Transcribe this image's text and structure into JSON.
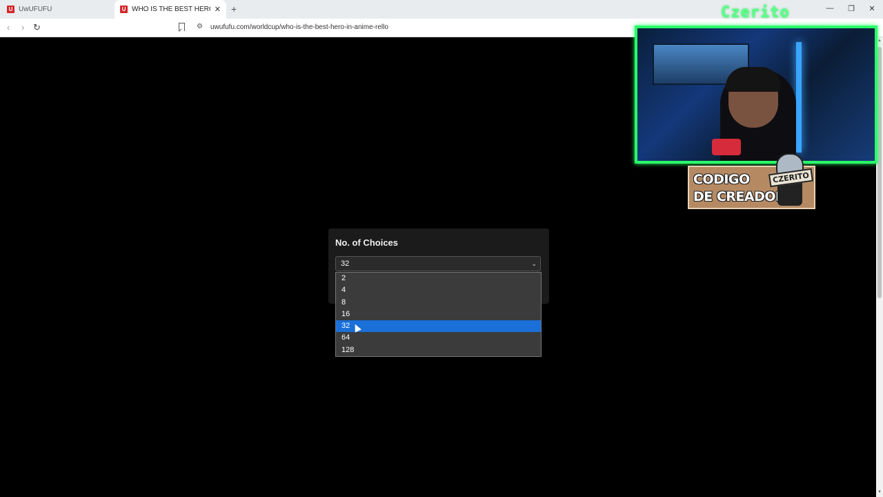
{
  "browser": {
    "tabs": [
      {
        "title": "UwUFUFU",
        "favicon": "U"
      },
      {
        "title": "WHO IS THE BEST HERO IN ANIME",
        "favicon": "U"
      }
    ],
    "new_tab_icon": "+",
    "window_controls": {
      "minimize": "—",
      "maximize": "❐",
      "close": "✕"
    },
    "nav": {
      "back": "‹",
      "forward": "›",
      "reload": "↻"
    },
    "url": "uwufufu.com/worldcup/who-is-the-best-hero-in-anime-rello"
  },
  "main": {
    "card_title": "No. of Choices",
    "selected_value": "32",
    "options": [
      "2",
      "4",
      "8",
      "16",
      "32",
      "64",
      "128"
    ],
    "selected_index": 4,
    "accent_color": "#1a6fd8"
  },
  "overlay": {
    "streamer_name": "Czerito",
    "creator_code_text": "CODIGO\nDE CREADOR",
    "creator_code_badge": "CZERITO",
    "frame_color": "#2bff6a"
  }
}
